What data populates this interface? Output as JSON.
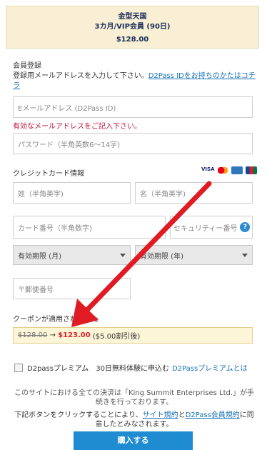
{
  "summary": {
    "product": "金型天国",
    "plan": "3カ月/VIP会員 (90日)",
    "price": "$128.00"
  },
  "registration": {
    "heading": "会員登録",
    "instruction": "登録用メールアドレスを入力して下さい。",
    "link": "D2Pass IDをお持ちのかたはコチラ",
    "email_placeholder": "Eメールアドレス (D2Pass ID)",
    "email_error": "有効なメールアドレスをご記入下さい。",
    "password_placeholder": "パスワード（半角英数6〜14字)"
  },
  "credit": {
    "heading": "クレジットカード情報",
    "card_brands": [
      "VISA",
      "mastercard",
      "amex",
      "JCB"
    ],
    "lastname_placeholder": "姓（半角英字)",
    "firstname_placeholder": "名（半角英字)",
    "card_number_placeholder": "カード番号（半角数字)",
    "security_placeholder": "セキュリティー番号",
    "help_icon": "?",
    "exp_month": "有効期限 (月)",
    "exp_year": "有効期限 (年)",
    "zip_placeholder": "〒郵便番号"
  },
  "coupon": {
    "heading": "クーポンが適用されました",
    "old_price": "$128.00",
    "arrow": "→",
    "new_price": "$123.00",
    "discount": "($5.00割引後)"
  },
  "premium": {
    "label": "D2passプレミアム　30日無料体験に申込む",
    "link": "D2Passプレミアムとは"
  },
  "notice": {
    "line1": "このサイトにおける全ての決済は「King Summit Enterprises Ltd.」が手続きを行っております。",
    "line2_prefix": "下記ボタンをクリックすることにより、",
    "terms_link": "サイト規約",
    "and": "と",
    "d2pass_terms_link": "D2Pass会員規約",
    "line2_suffix": "に同意したとみなされます。"
  },
  "buy_button": "購入する",
  "colors": {
    "arrow": "#e01b24",
    "button": "#1f8bd1",
    "link": "#1a73b8",
    "error": "#c0143c"
  }
}
